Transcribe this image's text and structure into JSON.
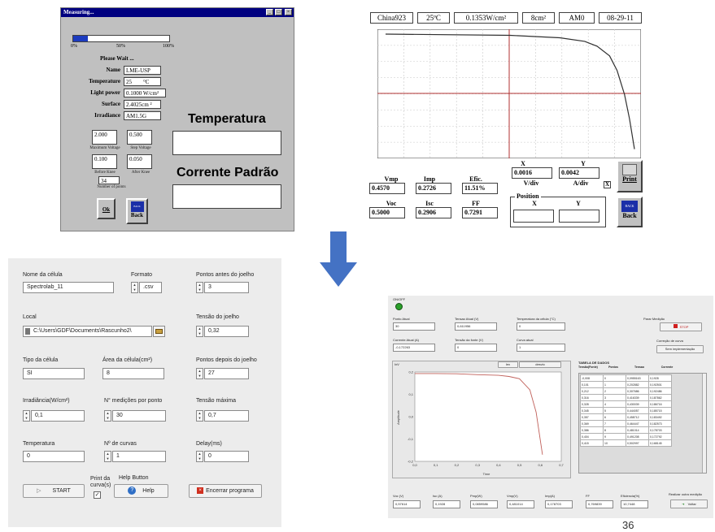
{
  "measuring_window": {
    "title": "Measuring...",
    "progress": {
      "fraction": 0.15,
      "tick_0": "0%",
      "tick_50": "50%",
      "tick_100": "100%",
      "color": "#1c3bbf"
    },
    "please_wait": "Please Wait ...",
    "name_label": "Name",
    "name_value": "LME-USP",
    "temperature_label": "Temperature",
    "temperature_value": "25",
    "temperature_unit": "°C",
    "light_power_label": "Light power",
    "light_power_value": "0.1000 W/cm²",
    "surface_label": "Surface",
    "surface_value": "2.4025cm ²",
    "irradiance_label": "Irradiance",
    "irradiance_value": "AM1.5G",
    "max_voltage_value": "2.000",
    "max_voltage_label": "Maximum Voltage",
    "step_voltage_value": "0.500",
    "step_voltage_label": "Step Voltage",
    "before_knee_value": "0.100",
    "before_knee_label": "Before Knee",
    "after_knee_value": "0.050",
    "after_knee_label": "After Knee",
    "points_value": "34",
    "points_label": "Number of points",
    "ok_label": "Ok",
    "back_label": "Back",
    "temperatura_heading": "Temperatura",
    "corrente_heading": "Corrente Padrão"
  },
  "iv_window": {
    "header": [
      "China923",
      "25ºC",
      "0.1353W/cm²",
      "8cm²",
      "AM0",
      "08-29-11"
    ],
    "x_label": "X",
    "y_label": "Y",
    "x_value": "0.0016",
    "y_value": "0.0042",
    "vdiv_label": "V/div",
    "adiv_label": "A/div",
    "close_mark": "X",
    "vmp_label": "Vmp",
    "vmp_value": "0.4570",
    "imp_label": "Imp",
    "imp_value": "0.2726",
    "efic_label": "Efic.",
    "efic_value": "11.51%",
    "voc_label": "Voc",
    "voc_value": "0.5000",
    "isc_label": "Isc",
    "isc_value": "0.2906",
    "ff_label": "FF",
    "ff_value": "0.7291",
    "position_label": "Position",
    "pos_x_label": "X",
    "pos_y_label": "Y",
    "print_label": "Print",
    "back_label": "Back"
  },
  "config_form": {
    "nome_label": "Nome da célula",
    "nome_value": "Spectrolab_11",
    "formato_label": "Formato",
    "formato_value": ".csv",
    "pontos_antes_label": "Pontos antes do joelho",
    "pontos_antes_value": "3",
    "local_label": "Local",
    "local_value": "C:\\Users\\GDF\\Documents\\Rascunho2\\",
    "tensao_joelho_label": "Tensão do joelho",
    "tensao_joelho_value": "0,32",
    "tipo_label": "Tipo da célula",
    "tipo_value": "SI",
    "area_label": "Área da célula(cm²)",
    "area_value": "8",
    "pontos_depois_label": "Pontos depois do joelho",
    "pontos_depois_value": "27",
    "irradiancia_label": "Irradiância(W/cm²)",
    "irradiancia_value": "0,1",
    "medicoes_label": "N° medições por ponto",
    "medicoes_value": "30",
    "tensao_max_label": "Tensão máxima",
    "tensao_max_value": "0,7",
    "temperatura_label": "Temperatura",
    "temperatura_value": "0",
    "curvas_label": "Nº de curvas",
    "curvas_value": "1",
    "delay_label": "Delay(ms)",
    "delay_value": "0",
    "start_label": "START",
    "print_label": "Print da curva(s)",
    "help_caption": "Help Button",
    "help_label": "Help",
    "encerrar_label": "Encerrar programa"
  },
  "measure_panel": {
    "onoff_label": "ON/OFF",
    "ponto_atual_label": "Ponto Atual",
    "ponto_atual_value": "30",
    "tensao_atual_label": "Tensao Atual (V)",
    "tensao_atual_value": "0,611956",
    "temp_celula_label": "Temperatura da célula (°C)",
    "temp_celula_value": "0",
    "corrente_atual_label": "Corrente Atual (A)",
    "corrente_atual_value": "-0,172263",
    "tensao_fonte_label": "Tensão da fonte (V)",
    "tensao_fonte_value": "0",
    "curva_atual_label": "Curva atual",
    "curva_atual_value": "1",
    "parar_label": "Parar Medição",
    "stop_label": "STOP",
    "correcao_label": "Correção de curva",
    "correcao_value": "Sem implementação",
    "chart_title": "IxV",
    "chart_mode_left": "Iex",
    "chart_mode_right": "desvio",
    "amplitude_label": "Amplitude",
    "time_label": "Time",
    "tabela_title": "TABELA DE DADOS",
    "table_headers": [
      "Tensão(Fonte)",
      "Pontos",
      "Tensao",
      "Corrente"
    ],
    "table_rows": [
      [
        "-0,008",
        "0",
        "0,0955163",
        "0,1928"
      ],
      [
        "0,101",
        "1",
        "0,202882",
        "0,192501"
      ],
      [
        "0,212",
        "2",
        "0,307686",
        "0,192486"
      ],
      [
        "0,316",
        "3",
        "0,416339",
        "0,187862"
      ],
      [
        "0,328",
        "4",
        "0,430039",
        "0,186716"
      ],
      [
        "0,345",
        "5",
        "0,444057",
        "0,185715"
      ],
      [
        "0,357",
        "6",
        "0,458712",
        "0,183492"
      ],
      [
        "0,369",
        "7",
        "0,464447",
        "0,182573"
      ],
      [
        "0,386",
        "8",
        "0,481014",
        "0,178703"
      ],
      [
        "0,404",
        "9",
        "0,491208",
        "0,172792"
      ],
      [
        "0,415",
        "10",
        "0,502997",
        "0,168145"
      ]
    ],
    "voc_label": "Voc (V)",
    "voc_value": "0,57614",
    "isc_label": "Isc (A)",
    "isc_value": "0,1928",
    "pmp_label": "Pmp(W)",
    "pmp_value": "0,0859586",
    "vmp_label": "Vmp(V)",
    "vmp_value": "0,481014",
    "imp_label": "Imp(A)",
    "imp_value": "0,178703",
    "ff_label": "FF",
    "ff_value": "0,769839",
    "eficiencia_label": "Eficiencia(%)",
    "eficiencia_value": "10,7448",
    "realizar_label": "Realizar outra medição",
    "voltar_label": "Voltar"
  },
  "page_number": "36",
  "chart_data": [
    {
      "type": "line",
      "title": "",
      "xlabel": "",
      "ylabel": "",
      "grid": true,
      "series": [
        {
          "x": [
            0.0,
            0.5,
            0.7,
            0.8,
            0.85,
            0.9,
            0.93,
            0.96,
            0.98,
            1.0
          ],
          "y": [
            1.0,
            0.99,
            0.97,
            0.94,
            0.9,
            0.82,
            0.7,
            0.5,
            0.3,
            0.05
          ]
        }
      ]
    },
    {
      "type": "line",
      "title": "IxV",
      "xlabel": "Time",
      "ylabel": "Amplitude",
      "xlim": [
        0,
        0.7
      ],
      "ylim": [
        -0.2,
        0.2
      ],
      "xticks": [
        "0,0",
        "0,1",
        "0,2",
        "0,3",
        "0,4",
        "0,5",
        "0,6",
        "0,7"
      ],
      "yticks": [
        "0,2",
        "0,1",
        "0,0",
        "-0,1",
        "-0,2"
      ],
      "grid": false,
      "series": [
        {
          "x": [
            0.0,
            0.1,
            0.2,
            0.3,
            0.4,
            0.45,
            0.5,
            0.55,
            0.58,
            0.61
          ],
          "y": [
            0.193,
            0.193,
            0.192,
            0.188,
            0.185,
            0.18,
            0.17,
            0.12,
            0.02,
            -0.17
          ]
        }
      ]
    }
  ]
}
